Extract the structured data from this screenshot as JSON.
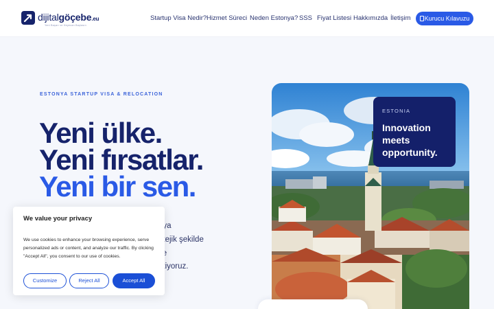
{
  "header": {
    "logo_prefix": "dijital",
    "logo_main": "göçebe",
    "logo_suffix": ".eu",
    "logo_tagline": "Yeni Başarı ve Heyecan Başlasın",
    "nav": [
      "Startup Visa Nedir?",
      "Hizmet Süreci",
      "Neden Estonya?",
      "SSS",
      "Fiyat Listesi",
      "Hakkımızda",
      "İletişim"
    ],
    "cta_label": "Kurucu Kılavuzu"
  },
  "hero": {
    "eyebrow": "ESTONYA STARTUP VISA & RELOCATION",
    "headline_1": "Yeni ülke.",
    "headline_2": "Yeni fırsatlar.",
    "headline_3": "Yeni bir sen.",
    "paragraph_fragments": [
      "nya",
      "atejik şekilde",
      "ve",
      "etiyoruz."
    ]
  },
  "image_card": {
    "badge_eyebrow": "ESTONIA",
    "badge_title": "Innovation meets opportunity."
  },
  "cookie_banner": {
    "title": "We value your privacy",
    "body": "We use cookies to enhance your browsing experience, serve personalized ads or content, and analyze our traffic. By clicking \"Accept All\", you consent to our use of cookies.",
    "customize": "Customize",
    "reject": "Reject All",
    "accept": "Accept All"
  },
  "colors": {
    "navy": "#16236b",
    "accent_blue": "#2a5ae6",
    "cookie_blue": "#1b4fd6",
    "page_bg": "#f5f7fc"
  }
}
